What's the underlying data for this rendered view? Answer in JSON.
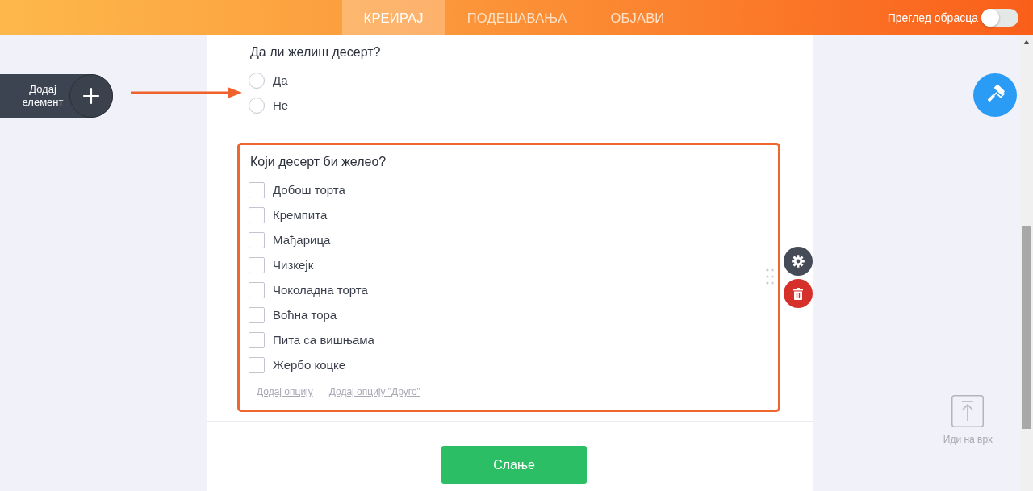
{
  "header": {
    "tabs": [
      {
        "label": "КРЕИРАЈ",
        "selected": true
      },
      {
        "label": "ПОДЕШАВАЊА",
        "selected": false
      },
      {
        "label": "ОБЈАВИ",
        "selected": false
      }
    ],
    "preview_toggle": {
      "label": "Преглед обрасца",
      "on": false
    }
  },
  "left_panel": {
    "add_element_button": {
      "label": "Додај елемент"
    }
  },
  "form": {
    "questions": [
      {
        "kind": "radio",
        "title": "Да ли желиш десерт?",
        "selected": false,
        "options": [
          {
            "label": "Да",
            "selected": false
          },
          {
            "label": "Не",
            "selected": false
          }
        ]
      },
      {
        "kind": "checkbox",
        "title": "Који десерт би желео?",
        "selected": true,
        "options": [
          {
            "label": "Добош торта",
            "checked": false
          },
          {
            "label": "Кремпита",
            "checked": false
          },
          {
            "label": "Мађарица",
            "checked": false
          },
          {
            "label": "Чизкејк",
            "checked": false
          },
          {
            "label": "Чоколадна торта",
            "checked": false
          },
          {
            "label": "Воћна тора",
            "checked": false
          },
          {
            "label": "Пита са вишњама",
            "checked": false
          },
          {
            "label": "Жербо коцке",
            "checked": false
          }
        ],
        "add_option_links": [
          "Додај опцију",
          "Додај опцију \"Друго\""
        ]
      }
    ],
    "submit_button": {
      "label": "Слање"
    }
  },
  "right_panel": {
    "scroll_to_top": {
      "label": "Иди на врх"
    }
  }
}
